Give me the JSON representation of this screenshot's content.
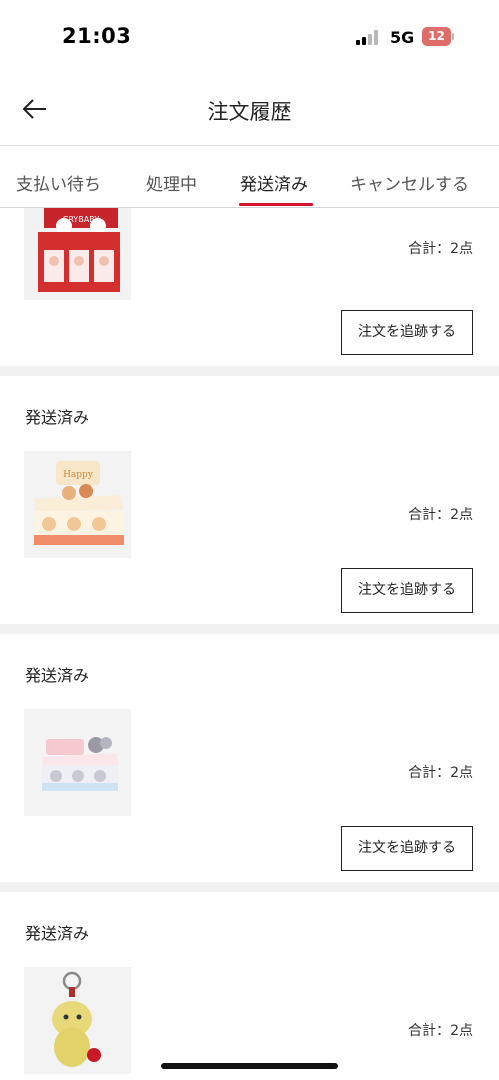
{
  "status_bar": {
    "time": "21:03",
    "network": "5G",
    "battery_level": "12",
    "battery_color": "#d9534f"
  },
  "header": {
    "title": "注文履歴",
    "back_icon": "arrow-left-icon"
  },
  "tabs": [
    {
      "label": "支払い待ち",
      "active": false
    },
    {
      "label": "処理中",
      "active": false
    },
    {
      "label": "発送済み",
      "active": true
    },
    {
      "label": "キャンセルする",
      "active": false
    }
  ],
  "accent_color": "#d6112a",
  "orders": [
    {
      "status": "",
      "total": "合計：2点",
      "track_label": "注文を追跡する",
      "thumb": "red-blind-box-display"
    },
    {
      "status": "発送済み",
      "total": "合計：2点",
      "track_label": "注文を追跡する",
      "thumb": "cream-orange-blind-box-display"
    },
    {
      "status": "発送済み",
      "total": "合計：2点",
      "track_label": "注文を追跡する",
      "thumb": "pastel-blind-box-display"
    },
    {
      "status": "発送済み",
      "total": "合計：2点",
      "track_label": "",
      "thumb": "yellow-plush-keychain"
    }
  ]
}
